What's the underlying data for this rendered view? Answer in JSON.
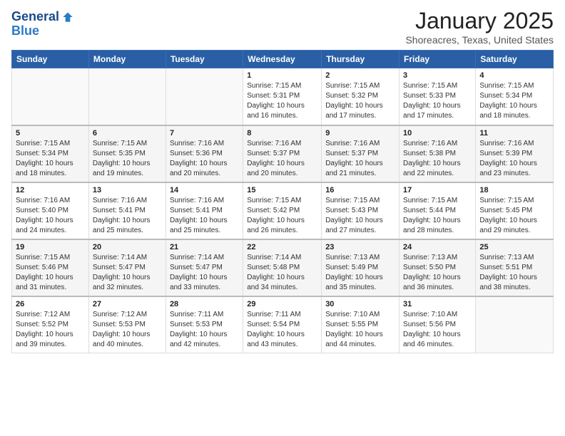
{
  "header": {
    "logo_line1": "General",
    "logo_line2": "Blue",
    "title": "January 2025",
    "subtitle": "Shoreacres, Texas, United States"
  },
  "weekdays": [
    "Sunday",
    "Monday",
    "Tuesday",
    "Wednesday",
    "Thursday",
    "Friday",
    "Saturday"
  ],
  "weeks": [
    [
      {
        "day": "",
        "info": ""
      },
      {
        "day": "",
        "info": ""
      },
      {
        "day": "",
        "info": ""
      },
      {
        "day": "1",
        "info": "Sunrise: 7:15 AM\nSunset: 5:31 PM\nDaylight: 10 hours\nand 16 minutes."
      },
      {
        "day": "2",
        "info": "Sunrise: 7:15 AM\nSunset: 5:32 PM\nDaylight: 10 hours\nand 17 minutes."
      },
      {
        "day": "3",
        "info": "Sunrise: 7:15 AM\nSunset: 5:33 PM\nDaylight: 10 hours\nand 17 minutes."
      },
      {
        "day": "4",
        "info": "Sunrise: 7:15 AM\nSunset: 5:34 PM\nDaylight: 10 hours\nand 18 minutes."
      }
    ],
    [
      {
        "day": "5",
        "info": "Sunrise: 7:15 AM\nSunset: 5:34 PM\nDaylight: 10 hours\nand 18 minutes."
      },
      {
        "day": "6",
        "info": "Sunrise: 7:15 AM\nSunset: 5:35 PM\nDaylight: 10 hours\nand 19 minutes."
      },
      {
        "day": "7",
        "info": "Sunrise: 7:16 AM\nSunset: 5:36 PM\nDaylight: 10 hours\nand 20 minutes."
      },
      {
        "day": "8",
        "info": "Sunrise: 7:16 AM\nSunset: 5:37 PM\nDaylight: 10 hours\nand 20 minutes."
      },
      {
        "day": "9",
        "info": "Sunrise: 7:16 AM\nSunset: 5:37 PM\nDaylight: 10 hours\nand 21 minutes."
      },
      {
        "day": "10",
        "info": "Sunrise: 7:16 AM\nSunset: 5:38 PM\nDaylight: 10 hours\nand 22 minutes."
      },
      {
        "day": "11",
        "info": "Sunrise: 7:16 AM\nSunset: 5:39 PM\nDaylight: 10 hours\nand 23 minutes."
      }
    ],
    [
      {
        "day": "12",
        "info": "Sunrise: 7:16 AM\nSunset: 5:40 PM\nDaylight: 10 hours\nand 24 minutes."
      },
      {
        "day": "13",
        "info": "Sunrise: 7:16 AM\nSunset: 5:41 PM\nDaylight: 10 hours\nand 25 minutes."
      },
      {
        "day": "14",
        "info": "Sunrise: 7:16 AM\nSunset: 5:41 PM\nDaylight: 10 hours\nand 25 minutes."
      },
      {
        "day": "15",
        "info": "Sunrise: 7:15 AM\nSunset: 5:42 PM\nDaylight: 10 hours\nand 26 minutes."
      },
      {
        "day": "16",
        "info": "Sunrise: 7:15 AM\nSunset: 5:43 PM\nDaylight: 10 hours\nand 27 minutes."
      },
      {
        "day": "17",
        "info": "Sunrise: 7:15 AM\nSunset: 5:44 PM\nDaylight: 10 hours\nand 28 minutes."
      },
      {
        "day": "18",
        "info": "Sunrise: 7:15 AM\nSunset: 5:45 PM\nDaylight: 10 hours\nand 29 minutes."
      }
    ],
    [
      {
        "day": "19",
        "info": "Sunrise: 7:15 AM\nSunset: 5:46 PM\nDaylight: 10 hours\nand 31 minutes."
      },
      {
        "day": "20",
        "info": "Sunrise: 7:14 AM\nSunset: 5:47 PM\nDaylight: 10 hours\nand 32 minutes."
      },
      {
        "day": "21",
        "info": "Sunrise: 7:14 AM\nSunset: 5:47 PM\nDaylight: 10 hours\nand 33 minutes."
      },
      {
        "day": "22",
        "info": "Sunrise: 7:14 AM\nSunset: 5:48 PM\nDaylight: 10 hours\nand 34 minutes."
      },
      {
        "day": "23",
        "info": "Sunrise: 7:13 AM\nSunset: 5:49 PM\nDaylight: 10 hours\nand 35 minutes."
      },
      {
        "day": "24",
        "info": "Sunrise: 7:13 AM\nSunset: 5:50 PM\nDaylight: 10 hours\nand 36 minutes."
      },
      {
        "day": "25",
        "info": "Sunrise: 7:13 AM\nSunset: 5:51 PM\nDaylight: 10 hours\nand 38 minutes."
      }
    ],
    [
      {
        "day": "26",
        "info": "Sunrise: 7:12 AM\nSunset: 5:52 PM\nDaylight: 10 hours\nand 39 minutes."
      },
      {
        "day": "27",
        "info": "Sunrise: 7:12 AM\nSunset: 5:53 PM\nDaylight: 10 hours\nand 40 minutes."
      },
      {
        "day": "28",
        "info": "Sunrise: 7:11 AM\nSunset: 5:53 PM\nDaylight: 10 hours\nand 42 minutes."
      },
      {
        "day": "29",
        "info": "Sunrise: 7:11 AM\nSunset: 5:54 PM\nDaylight: 10 hours\nand 43 minutes."
      },
      {
        "day": "30",
        "info": "Sunrise: 7:10 AM\nSunset: 5:55 PM\nDaylight: 10 hours\nand 44 minutes."
      },
      {
        "day": "31",
        "info": "Sunrise: 7:10 AM\nSunset: 5:56 PM\nDaylight: 10 hours\nand 46 minutes."
      },
      {
        "day": "",
        "info": ""
      }
    ]
  ]
}
